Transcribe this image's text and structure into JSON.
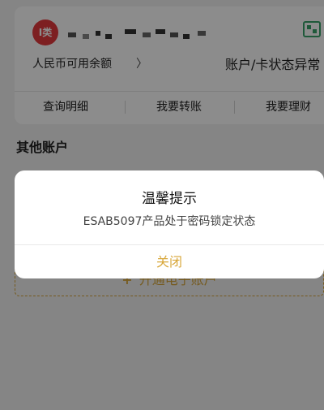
{
  "card": {
    "badge": "I类",
    "balance_label": "人民币可用余额",
    "chevron": "〉",
    "status": "账户/卡状态异常"
  },
  "actions": [
    {
      "label": "查询明细"
    },
    {
      "label": "我要转账"
    },
    {
      "label": "我要理财"
    }
  ],
  "other_accounts": {
    "title": "其他账户",
    "open_label": "开通电子账户",
    "open_plus": "+"
  },
  "dialog": {
    "title": "温馨提示",
    "message": "ESAB5097产品处于密码锁定状态",
    "close_label": "关闭"
  },
  "colors": {
    "accent": "#d8a73b",
    "badge": "#e4393c",
    "qr": "#3aa36a"
  },
  "icons": {
    "qr": "qr-code-icon",
    "chevron": "chevron-right-icon"
  }
}
